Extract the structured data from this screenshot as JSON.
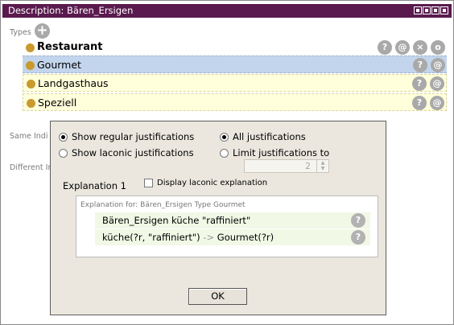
{
  "window": {
    "title": "Description: Bären_Ersigen"
  },
  "types": {
    "label": "Types",
    "items": [
      {
        "label": "Restaurant",
        "style": "header"
      },
      {
        "label": "Gourmet",
        "style": "selected"
      },
      {
        "label": "Landgasthaus",
        "style": "inferred"
      },
      {
        "label": "Speziell",
        "style": "inferred"
      }
    ]
  },
  "sections": {
    "same_individual": "Same Indi",
    "different_individuals": "Different In"
  },
  "dialog": {
    "show_regular": "Show regular justifications",
    "show_laconic": "Show laconic justifications",
    "all_justifications": "All justifications",
    "limit_justifications": "Limit justifications to",
    "limit_value": "2",
    "explanation_title": "Explanation 1",
    "display_laconic_label": "Display laconic explanation",
    "explanation_for": "Explanation for: Bären_Ersigen Type Gourmet",
    "axioms": [
      {
        "text": "Bären_Ersigen küche \"raffiniert\""
      },
      {
        "before": "küche(?r, \"raffiniert\") ",
        "arrow": "->",
        "after": " Gourmet(?r)"
      }
    ],
    "ok_label": "OK",
    "selected_mode": "regular",
    "selected_scope": "all"
  },
  "icons": {
    "help": "?",
    "annotate": "@",
    "delete": "×",
    "options": "o",
    "add": "+"
  },
  "colors": {
    "titlebar": "#5a1a4e",
    "selected_row": "#c3d5ec",
    "inferred_row": "#ffffdc",
    "class_bullet": "#c99a2e",
    "dialog_bg": "#ebe7de"
  }
}
